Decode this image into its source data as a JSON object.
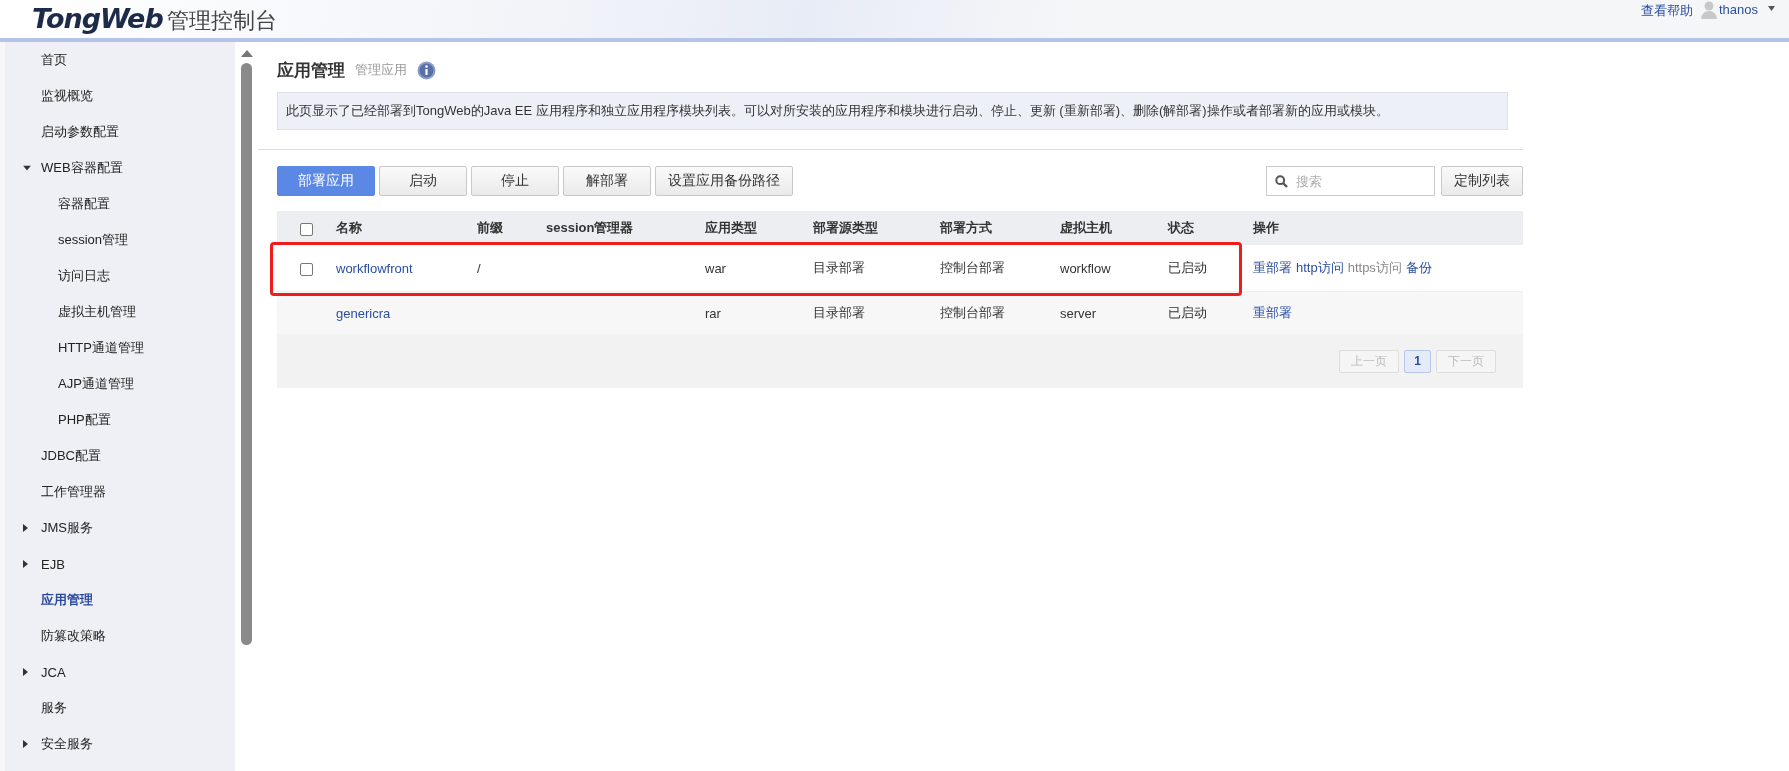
{
  "header": {
    "logo_brand": "TongWeb",
    "logo_suffix": "管理控制台",
    "help_link": "查看帮助",
    "user": "thanos"
  },
  "sidebar": {
    "items": [
      {
        "label": "首页",
        "kind": "leaf",
        "selected": false
      },
      {
        "label": "监视概览",
        "kind": "leaf",
        "selected": false
      },
      {
        "label": "启动参数配置",
        "kind": "leaf",
        "selected": false
      },
      {
        "label": "WEB容器配置",
        "kind": "group",
        "expanded": true,
        "selected": false,
        "children": [
          {
            "label": "容器配置",
            "kind": "leaf",
            "selected": false
          },
          {
            "label": "session管理",
            "kind": "leaf",
            "selected": false
          },
          {
            "label": "访问日志",
            "kind": "leaf",
            "selected": false
          },
          {
            "label": "虚拟主机管理",
            "kind": "leaf",
            "selected": false
          },
          {
            "label": "HTTP通道管理",
            "kind": "leaf",
            "selected": false
          },
          {
            "label": "AJP通道管理",
            "kind": "leaf",
            "selected": false
          },
          {
            "label": "PHP配置",
            "kind": "leaf",
            "selected": false
          }
        ]
      },
      {
        "label": "JDBC配置",
        "kind": "leaf",
        "selected": false
      },
      {
        "label": "工作管理器",
        "kind": "leaf",
        "selected": false
      },
      {
        "label": "JMS服务",
        "kind": "group",
        "expanded": false,
        "selected": false
      },
      {
        "label": "EJB",
        "kind": "group",
        "expanded": false,
        "selected": false
      },
      {
        "label": "应用管理",
        "kind": "leaf",
        "selected": true
      },
      {
        "label": "防篡改策略",
        "kind": "leaf",
        "selected": false
      },
      {
        "label": "JCA",
        "kind": "group",
        "expanded": false,
        "selected": false
      },
      {
        "label": "服务",
        "kind": "leaf",
        "selected": false
      },
      {
        "label": "安全服务",
        "kind": "group",
        "expanded": false,
        "selected": false
      }
    ]
  },
  "page": {
    "title": "应用管理",
    "subtitle": "管理应用",
    "description": "此页显示了已经部署到TongWeb的Java EE 应用程序和独立应用程序模块列表。可以对所安装的应用程序和模块进行启动、停止、更新 (重新部署)、删除(解部署)操作或者部署新的应用或模块。"
  },
  "toolbar": {
    "buttons": [
      {
        "label": "部署应用",
        "kind": "primary"
      },
      {
        "label": "启动",
        "kind": "normal"
      },
      {
        "label": "停止",
        "kind": "normal"
      },
      {
        "label": "解部署",
        "kind": "normal"
      },
      {
        "label": "设置应用备份路径",
        "kind": "normal"
      }
    ],
    "search": {
      "placeholder": "搜索"
    },
    "customize_button": "定制列表"
  },
  "table": {
    "select_all": {
      "checked": false
    },
    "columns": [
      "名称",
      "前缀",
      "session管理器",
      "应用类型",
      "部署源类型",
      "部署方式",
      "虚拟主机",
      "状态",
      "操作"
    ],
    "rows": [
      {
        "kind": "checkable",
        "checked": false,
        "highlighted": true,
        "name": "workflowfront",
        "prefix": "/",
        "session_manager": "",
        "type": "war",
        "source_type": "目录部署",
        "deploy_mode": "控制台部署",
        "virtual_host": "workflow",
        "status": "已启动",
        "actions": [
          {
            "label": "重部署",
            "disabled": false
          },
          {
            "label": "http访问",
            "disabled": false
          },
          {
            "label": "https访问",
            "disabled": true
          },
          {
            "label": "备份",
            "disabled": false
          }
        ]
      },
      {
        "kind": "plain",
        "highlighted": false,
        "name": "genericra",
        "prefix": "",
        "session_manager": "",
        "type": "rar",
        "source_type": "目录部署",
        "deploy_mode": "控制台部署",
        "virtual_host": "server",
        "status": "已启动",
        "actions": [
          {
            "label": "重部署",
            "disabled": false
          }
        ]
      }
    ]
  },
  "pagination": {
    "prev": {
      "label": "上一页",
      "disabled": true
    },
    "pages": [
      {
        "label": "1",
        "selected": true
      }
    ],
    "next": {
      "label": "下一页",
      "disabled": true
    }
  }
}
